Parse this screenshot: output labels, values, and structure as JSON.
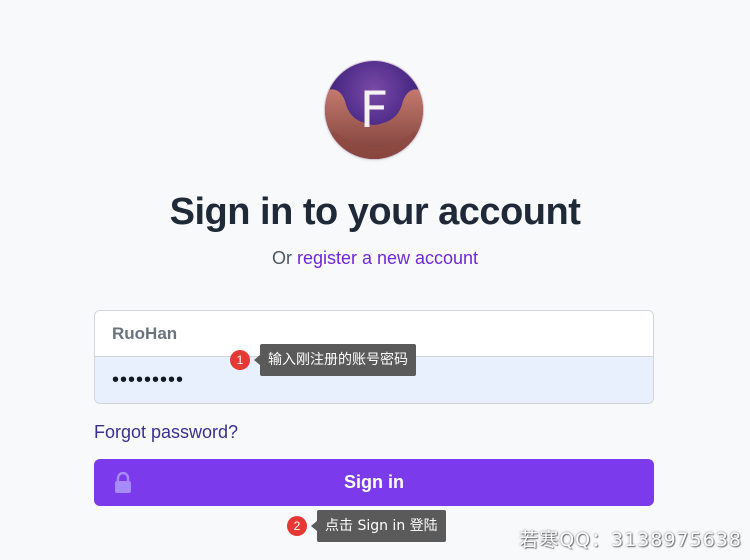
{
  "header": {
    "logo_letter": "F",
    "title": "Sign in to your account",
    "subtitle_prefix": "Or",
    "register_link": "register a new account"
  },
  "form": {
    "username_value": "RuoHan",
    "password_value": "•••••••••",
    "forgot_link": "Forgot password?",
    "signin_button": "Sign in"
  },
  "annotations": [
    {
      "number": "1",
      "text": "输入刚注册的账号密码"
    },
    {
      "number": "2",
      "text": "点击 Sign in 登陆"
    }
  ],
  "watermark": "若寒QQ：3138975638",
  "colors": {
    "accent": "#7c3aed",
    "link": "#6d28d9",
    "page_background": "#f8f9fb",
    "badge": "#e53935"
  }
}
